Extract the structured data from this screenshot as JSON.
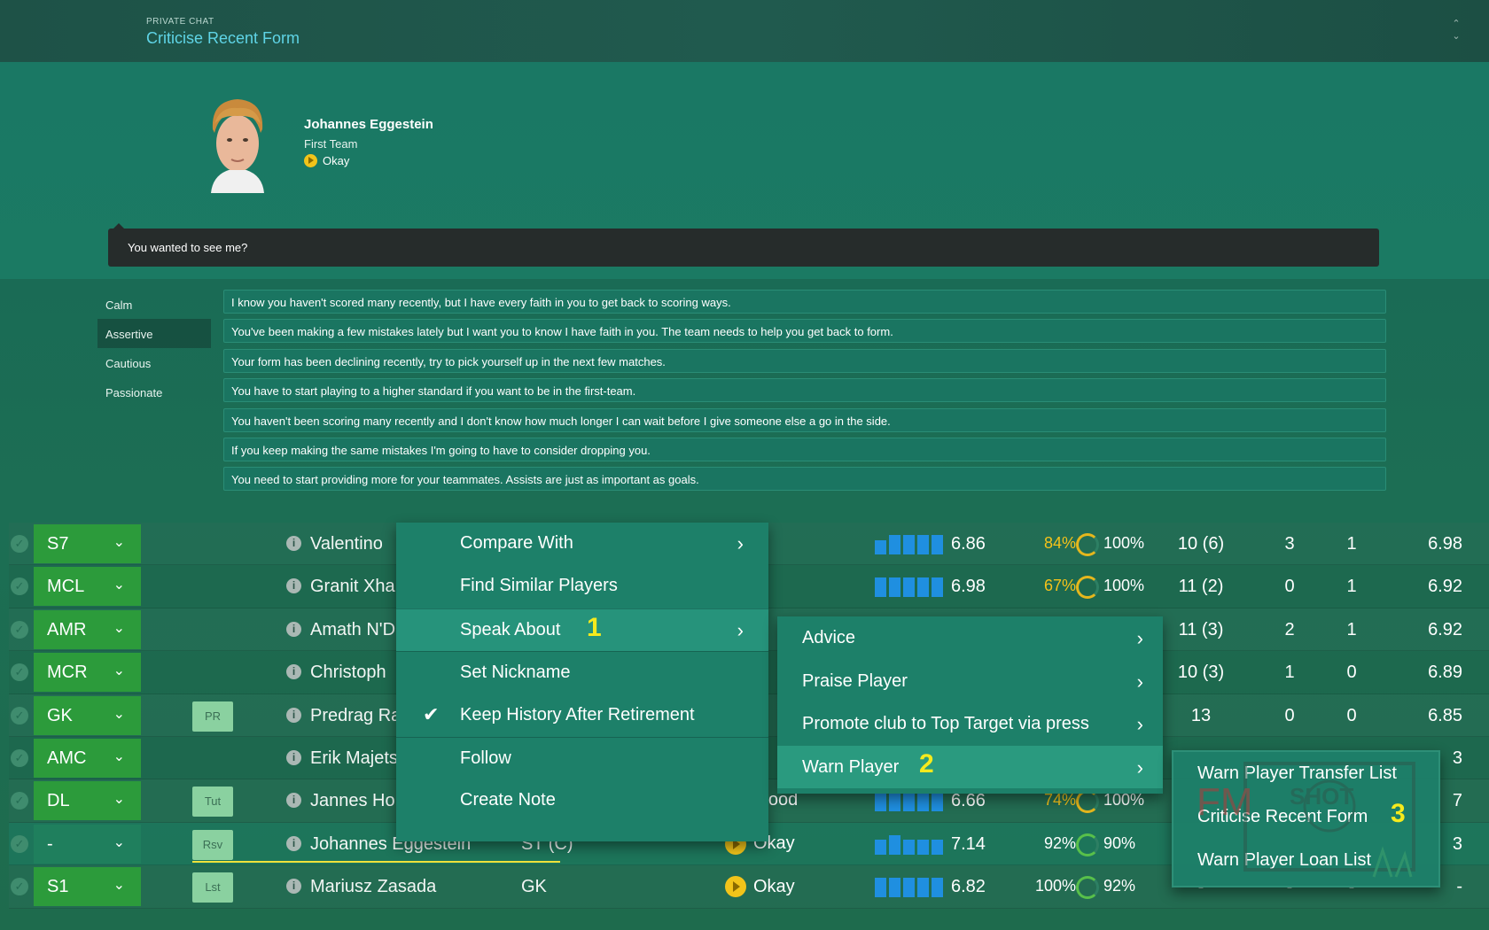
{
  "header": {
    "kicker": "PRIVATE CHAT",
    "title": "Criticise Recent Form"
  },
  "player": {
    "name": "Johannes Eggestein",
    "squad": "First Team",
    "morale": "Okay"
  },
  "speech": "You wanted to see me?",
  "tones": [
    "Calm",
    "Assertive",
    "Cautious",
    "Passionate"
  ],
  "active_tone": "Assertive",
  "options": [
    "I know you haven't scored many recently, but I have every faith in you to get back to scoring ways.",
    "You've been making a few mistakes lately but I want you to know I have faith in you. The team needs to help you get back to form.",
    "Your form has been declining recently, try to pick yourself up in the next few matches.",
    "You have to start playing to a higher standard if you want to be in the first-team.",
    "You haven't been scoring many recently and I don't know how much longer I can wait before I give someone else a go in the side.",
    "If you keep making the same mistakes I'm going to have to consider dropping you.",
    "You need to start providing more for your teammates. Assists are just as important as goals."
  ],
  "rows": [
    {
      "pos": "S7",
      "tag": "",
      "name": "Valentino",
      "ppos": "",
      "morale": "ood",
      "rating": "6.86",
      "cond": "84%",
      "fit": "100%",
      "apps": "10 (6)",
      "gls": "3",
      "ast": "1",
      "avr": "6.98",
      "bars": [
        3,
        4,
        4,
        4,
        4
      ]
    },
    {
      "pos": "MCL",
      "tag": "",
      "name": "Granit Xha",
      "ppos": "",
      "morale": "ood",
      "rating": "6.98",
      "cond": "67%",
      "fit": "100%",
      "apps": "11 (2)",
      "gls": "0",
      "ast": "1",
      "avr": "6.92",
      "bars": [
        4,
        4,
        4,
        4,
        4
      ]
    },
    {
      "pos": "AMR",
      "tag": "",
      "name": "Amath N'D",
      "ppos": "",
      "morale": "",
      "rating": "",
      "cond": "",
      "fit": "",
      "apps": "11 (3)",
      "gls": "2",
      "ast": "1",
      "avr": "6.92",
      "bars": []
    },
    {
      "pos": "MCR",
      "tag": "",
      "name": "Christoph",
      "ppos": "",
      "morale": "",
      "rating": "",
      "cond": "",
      "fit": "",
      "apps": "10 (3)",
      "gls": "1",
      "ast": "0",
      "avr": "6.89",
      "bars": []
    },
    {
      "pos": "GK",
      "tag": "PR",
      "name": "Predrag Ra",
      "ppos": "",
      "morale": "",
      "rating": "",
      "cond": "",
      "fit": "",
      "apps": "13",
      "gls": "0",
      "ast": "0",
      "avr": "6.85",
      "bars": []
    },
    {
      "pos": "AMC",
      "tag": "",
      "name": "Erik Majets",
      "ppos": "",
      "morale": "",
      "rating": "",
      "cond": "",
      "fit": "",
      "apps": "",
      "gls": "",
      "ast": "",
      "avr": "3",
      "bars": []
    },
    {
      "pos": "DL",
      "tag": "Tut",
      "name": "Jannes Ho",
      "ppos": "",
      "morale": "ery Good",
      "rating": "6.66",
      "cond": "74%",
      "fit": "100%",
      "apps": "",
      "gls": "",
      "ast": "",
      "avr": "7",
      "bars": [
        4,
        4,
        4,
        4,
        4
      ]
    },
    {
      "pos": "-",
      "tag": "Rsv",
      "name": "Johannes Eggestein",
      "ppos": "ST (C)",
      "morale": "Okay",
      "rating": "7.14",
      "cond": "92%",
      "fit": "90%",
      "apps": "",
      "gls": "",
      "ast": "",
      "avr": "3",
      "bars": [
        3,
        4,
        3,
        3,
        3
      ]
    },
    {
      "pos": "S1",
      "tag": "Lst",
      "name": "Mariusz Zasada",
      "ppos": "GK",
      "morale": "Okay",
      "rating": "6.82",
      "cond": "100%",
      "fit": "92%",
      "apps": "-",
      "gls": "-",
      "ast": "-",
      "avr": "-",
      "bars": [
        4,
        4,
        4,
        4,
        4
      ]
    }
  ],
  "menu1": {
    "items": [
      "Compare With",
      "Find Similar Players",
      "Speak About",
      "Set Nickname",
      "Keep History After Retirement",
      "Follow",
      "Create Note"
    ],
    "step1": "1"
  },
  "menu2": {
    "items": [
      "Advice",
      "Praise Player",
      "Promote club to Top Target via press",
      "Warn Player"
    ],
    "step2": "2"
  },
  "menu3": {
    "items": [
      "Warn Player Transfer List",
      "Criticise Recent Form",
      "Warn Player Loan List"
    ],
    "step3": "3"
  },
  "colors": {
    "accent_title": "#5fd4e6",
    "position_badge": "#2c9b3b",
    "step_number": "#f6ea1d",
    "condition_warn": "#f5c21a"
  }
}
